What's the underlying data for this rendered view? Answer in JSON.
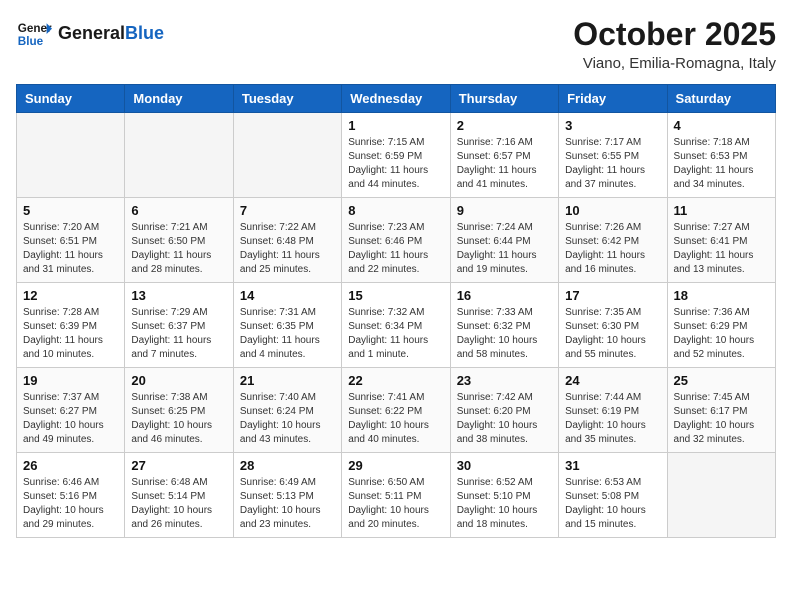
{
  "header": {
    "logo_line1": "General",
    "logo_line2": "Blue",
    "month_title": "October 2025",
    "location": "Viano, Emilia-Romagna, Italy"
  },
  "weekdays": [
    "Sunday",
    "Monday",
    "Tuesday",
    "Wednesday",
    "Thursday",
    "Friday",
    "Saturday"
  ],
  "weeks": [
    [
      {
        "day": "",
        "info": ""
      },
      {
        "day": "",
        "info": ""
      },
      {
        "day": "",
        "info": ""
      },
      {
        "day": "1",
        "info": "Sunrise: 7:15 AM\nSunset: 6:59 PM\nDaylight: 11 hours and 44 minutes."
      },
      {
        "day": "2",
        "info": "Sunrise: 7:16 AM\nSunset: 6:57 PM\nDaylight: 11 hours and 41 minutes."
      },
      {
        "day": "3",
        "info": "Sunrise: 7:17 AM\nSunset: 6:55 PM\nDaylight: 11 hours and 37 minutes."
      },
      {
        "day": "4",
        "info": "Sunrise: 7:18 AM\nSunset: 6:53 PM\nDaylight: 11 hours and 34 minutes."
      }
    ],
    [
      {
        "day": "5",
        "info": "Sunrise: 7:20 AM\nSunset: 6:51 PM\nDaylight: 11 hours and 31 minutes."
      },
      {
        "day": "6",
        "info": "Sunrise: 7:21 AM\nSunset: 6:50 PM\nDaylight: 11 hours and 28 minutes."
      },
      {
        "day": "7",
        "info": "Sunrise: 7:22 AM\nSunset: 6:48 PM\nDaylight: 11 hours and 25 minutes."
      },
      {
        "day": "8",
        "info": "Sunrise: 7:23 AM\nSunset: 6:46 PM\nDaylight: 11 hours and 22 minutes."
      },
      {
        "day": "9",
        "info": "Sunrise: 7:24 AM\nSunset: 6:44 PM\nDaylight: 11 hours and 19 minutes."
      },
      {
        "day": "10",
        "info": "Sunrise: 7:26 AM\nSunset: 6:42 PM\nDaylight: 11 hours and 16 minutes."
      },
      {
        "day": "11",
        "info": "Sunrise: 7:27 AM\nSunset: 6:41 PM\nDaylight: 11 hours and 13 minutes."
      }
    ],
    [
      {
        "day": "12",
        "info": "Sunrise: 7:28 AM\nSunset: 6:39 PM\nDaylight: 11 hours and 10 minutes."
      },
      {
        "day": "13",
        "info": "Sunrise: 7:29 AM\nSunset: 6:37 PM\nDaylight: 11 hours and 7 minutes."
      },
      {
        "day": "14",
        "info": "Sunrise: 7:31 AM\nSunset: 6:35 PM\nDaylight: 11 hours and 4 minutes."
      },
      {
        "day": "15",
        "info": "Sunrise: 7:32 AM\nSunset: 6:34 PM\nDaylight: 11 hours and 1 minute."
      },
      {
        "day": "16",
        "info": "Sunrise: 7:33 AM\nSunset: 6:32 PM\nDaylight: 10 hours and 58 minutes."
      },
      {
        "day": "17",
        "info": "Sunrise: 7:35 AM\nSunset: 6:30 PM\nDaylight: 10 hours and 55 minutes."
      },
      {
        "day": "18",
        "info": "Sunrise: 7:36 AM\nSunset: 6:29 PM\nDaylight: 10 hours and 52 minutes."
      }
    ],
    [
      {
        "day": "19",
        "info": "Sunrise: 7:37 AM\nSunset: 6:27 PM\nDaylight: 10 hours and 49 minutes."
      },
      {
        "day": "20",
        "info": "Sunrise: 7:38 AM\nSunset: 6:25 PM\nDaylight: 10 hours and 46 minutes."
      },
      {
        "day": "21",
        "info": "Sunrise: 7:40 AM\nSunset: 6:24 PM\nDaylight: 10 hours and 43 minutes."
      },
      {
        "day": "22",
        "info": "Sunrise: 7:41 AM\nSunset: 6:22 PM\nDaylight: 10 hours and 40 minutes."
      },
      {
        "day": "23",
        "info": "Sunrise: 7:42 AM\nSunset: 6:20 PM\nDaylight: 10 hours and 38 minutes."
      },
      {
        "day": "24",
        "info": "Sunrise: 7:44 AM\nSunset: 6:19 PM\nDaylight: 10 hours and 35 minutes."
      },
      {
        "day": "25",
        "info": "Sunrise: 7:45 AM\nSunset: 6:17 PM\nDaylight: 10 hours and 32 minutes."
      }
    ],
    [
      {
        "day": "26",
        "info": "Sunrise: 6:46 AM\nSunset: 5:16 PM\nDaylight: 10 hours and 29 minutes."
      },
      {
        "day": "27",
        "info": "Sunrise: 6:48 AM\nSunset: 5:14 PM\nDaylight: 10 hours and 26 minutes."
      },
      {
        "day": "28",
        "info": "Sunrise: 6:49 AM\nSunset: 5:13 PM\nDaylight: 10 hours and 23 minutes."
      },
      {
        "day": "29",
        "info": "Sunrise: 6:50 AM\nSunset: 5:11 PM\nDaylight: 10 hours and 20 minutes."
      },
      {
        "day": "30",
        "info": "Sunrise: 6:52 AM\nSunset: 5:10 PM\nDaylight: 10 hours and 18 minutes."
      },
      {
        "day": "31",
        "info": "Sunrise: 6:53 AM\nSunset: 5:08 PM\nDaylight: 10 hours and 15 minutes."
      },
      {
        "day": "",
        "info": ""
      }
    ]
  ]
}
